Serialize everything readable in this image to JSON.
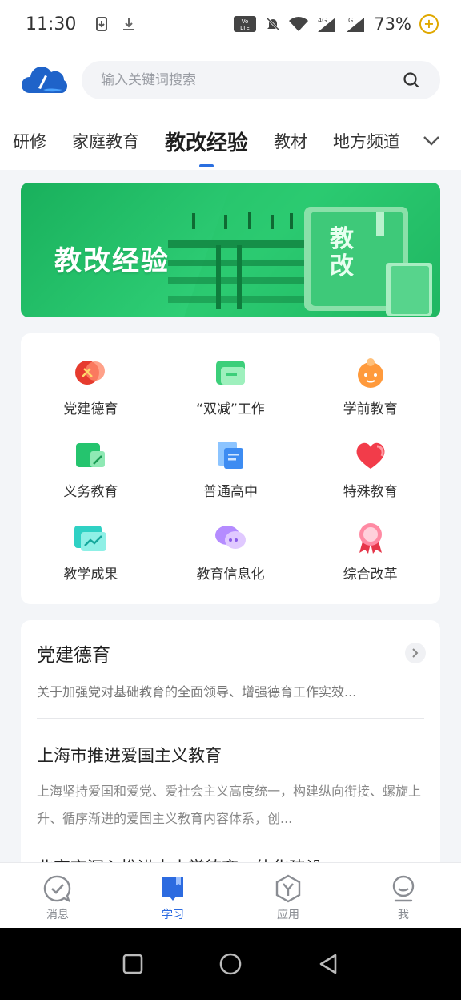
{
  "status": {
    "time": "11:30",
    "battery": "73%",
    "volte": "VoLTE",
    "net4g": "4G",
    "netg": "G"
  },
  "search": {
    "placeholder": "输入关键词搜索"
  },
  "tabs": [
    {
      "label": "研修"
    },
    {
      "label": "家庭教育"
    },
    {
      "label": "教改经验",
      "active": true
    },
    {
      "label": "教材"
    },
    {
      "label": "地方频道"
    }
  ],
  "banner": {
    "title": "教改经验",
    "book_text_1": "教",
    "book_text_2": "改"
  },
  "categories": [
    {
      "label": "党建德育",
      "icon": "party-emblem-icon"
    },
    {
      "label": "“双减”工作",
      "icon": "folder-icon"
    },
    {
      "label": "学前教育",
      "icon": "child-face-icon"
    },
    {
      "label": "义务教育",
      "icon": "book-pen-icon"
    },
    {
      "label": "普通高中",
      "icon": "document-stack-icon"
    },
    {
      "label": "特殊教育",
      "icon": "heart-icon"
    },
    {
      "label": "教学成果",
      "icon": "chart-board-icon"
    },
    {
      "label": "教育信息化",
      "icon": "chat-bubbles-icon"
    },
    {
      "label": "综合改革",
      "icon": "medal-icon"
    }
  ],
  "section": {
    "title": "党建德育",
    "desc": "关于加强党对基础教育的全面领导、增强德育工作实效..."
  },
  "articles": [
    {
      "title": "上海市推进爱国主义教育",
      "desc": "上海坚持爱国和爱党、爱社会主义高度统一，构建纵向衔接、螺旋上升、循序渐进的爱国主义教育内容体系，创..."
    },
    {
      "title": "北京市深入推进中小学德育一体化建设"
    }
  ],
  "bottom_nav": [
    {
      "label": "消息",
      "icon": "message-check-icon"
    },
    {
      "label": "学习",
      "icon": "study-book-icon",
      "active": true
    },
    {
      "label": "应用",
      "icon": "apps-hexagon-icon"
    },
    {
      "label": "我",
      "icon": "profile-icon"
    }
  ],
  "colors": {
    "accent": "#2c6be0",
    "banner_green": "#2fcf76"
  }
}
